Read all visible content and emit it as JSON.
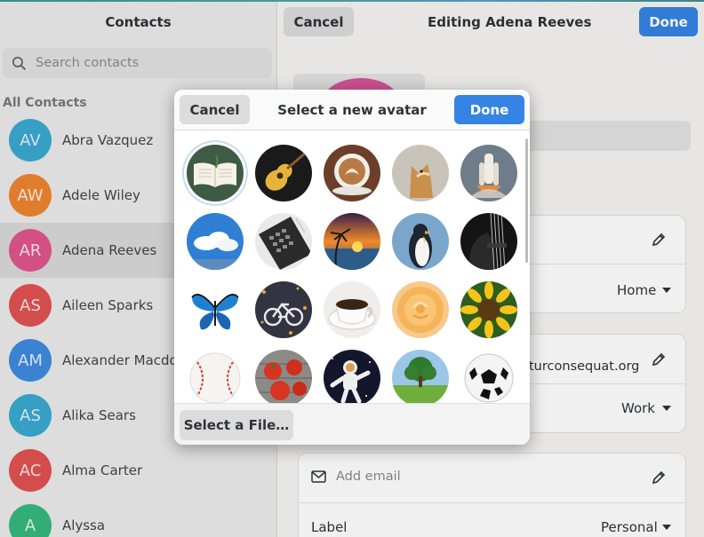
{
  "left_pane": {
    "title": "Contacts",
    "search_placeholder": "Search contacts",
    "section_label": "All Contacts",
    "contacts": [
      {
        "initials": "AV",
        "name": "Abra Vazquez",
        "color": "#3aa9d0"
      },
      {
        "initials": "AW",
        "name": "Adele Wiley",
        "color": "#ef8530"
      },
      {
        "initials": "AR",
        "name": "Adena Reeves",
        "color": "#e0558c"
      },
      {
        "initials": "AS",
        "name": "Aileen Sparks",
        "color": "#e05251"
      },
      {
        "initials": "AM",
        "name": "Alexander Macdonald",
        "color": "#3f8be0"
      },
      {
        "initials": "AS",
        "name": "Alika Sears",
        "color": "#3aa9d0"
      },
      {
        "initials": "AC",
        "name": "Alma Carter",
        "color": "#e05251"
      },
      {
        "initials": "A",
        "name": "Alyssa",
        "color": "#37b87e"
      }
    ]
  },
  "right_pane": {
    "cancel_label": "Cancel",
    "title": "Editing Adena Reeves",
    "done_label": "Done",
    "rows": {
      "phone_type": "Home",
      "email_partial": "turconsequat.org",
      "email_type": "Work",
      "add_email_placeholder": "Add email",
      "label_caption": "Label",
      "label_value": "Personal"
    }
  },
  "dialog": {
    "cancel_label": "Cancel",
    "title": "Select a new avatar",
    "done_label": "Done",
    "select_file_label": "Select a File…",
    "avatars": [
      "open-book",
      "acoustic-guitar",
      "latte-art",
      "cat",
      "space-shuttle",
      "clouds",
      "calculator",
      "tropical-sunset",
      "penguin",
      "bass-guitar",
      "blue-butterfly",
      "bicycle-graffiti",
      "coffee-cup",
      "yellow-rose",
      "sunflower",
      "baseball",
      "tomatoes",
      "astronaut",
      "tree-meadow",
      "soccer-ball"
    ]
  }
}
